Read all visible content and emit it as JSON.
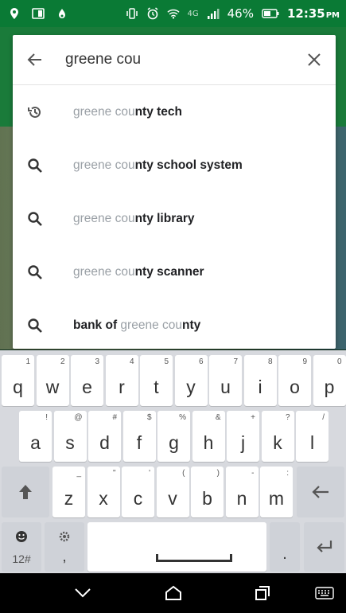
{
  "status_bar": {
    "signal": "4G",
    "battery": "46%",
    "time": "12:35",
    "ampm": "PM"
  },
  "search": {
    "query": "greene cou",
    "placeholder": ""
  },
  "suggestions": [
    {
      "icon": "history-icon",
      "segments": [
        {
          "t": "greene cou",
          "s": "muted"
        },
        {
          "t": "nty tech",
          "s": "strong"
        }
      ]
    },
    {
      "icon": "search-icon",
      "segments": [
        {
          "t": "greene cou",
          "s": "muted"
        },
        {
          "t": "nty school system",
          "s": "strong"
        }
      ]
    },
    {
      "icon": "search-icon",
      "segments": [
        {
          "t": "greene cou",
          "s": "muted"
        },
        {
          "t": "nty library",
          "s": "strong"
        }
      ]
    },
    {
      "icon": "search-icon",
      "segments": [
        {
          "t": "greene cou",
          "s": "muted"
        },
        {
          "t": "nty scanner",
          "s": "strong"
        }
      ]
    },
    {
      "icon": "search-icon",
      "segments": [
        {
          "t": "bank of ",
          "s": "strong"
        },
        {
          "t": "greene cou",
          "s": "muted"
        },
        {
          "t": "nty",
          "s": "strong"
        }
      ]
    }
  ],
  "keyboard": {
    "row1": [
      {
        "m": "q",
        "h": "1"
      },
      {
        "m": "w",
        "h": "2"
      },
      {
        "m": "e",
        "h": "3"
      },
      {
        "m": "r",
        "h": "4"
      },
      {
        "m": "t",
        "h": "5"
      },
      {
        "m": "y",
        "h": "6"
      },
      {
        "m": "u",
        "h": "7"
      },
      {
        "m": "i",
        "h": "8"
      },
      {
        "m": "o",
        "h": "9"
      },
      {
        "m": "p",
        "h": "0"
      }
    ],
    "row2": [
      {
        "m": "a",
        "h": "!"
      },
      {
        "m": "s",
        "h": "@"
      },
      {
        "m": "d",
        "h": "#"
      },
      {
        "m": "f",
        "h": "$"
      },
      {
        "m": "g",
        "h": "%"
      },
      {
        "m": "h",
        "h": "&"
      },
      {
        "m": "j",
        "h": "+"
      },
      {
        "m": "k",
        "h": "?"
      },
      {
        "m": "l",
        "h": "/"
      }
    ],
    "row3": [
      {
        "m": "z",
        "h": "_"
      },
      {
        "m": "x",
        "h": "\""
      },
      {
        "m": "c",
        "h": "'"
      },
      {
        "m": "v",
        "h": "("
      },
      {
        "m": "b",
        "h": ")"
      },
      {
        "m": "n",
        "h": "-"
      },
      {
        "m": "m",
        "h": ":"
      }
    ],
    "symbols_label": "12#",
    "comma": ",",
    "period": "."
  }
}
